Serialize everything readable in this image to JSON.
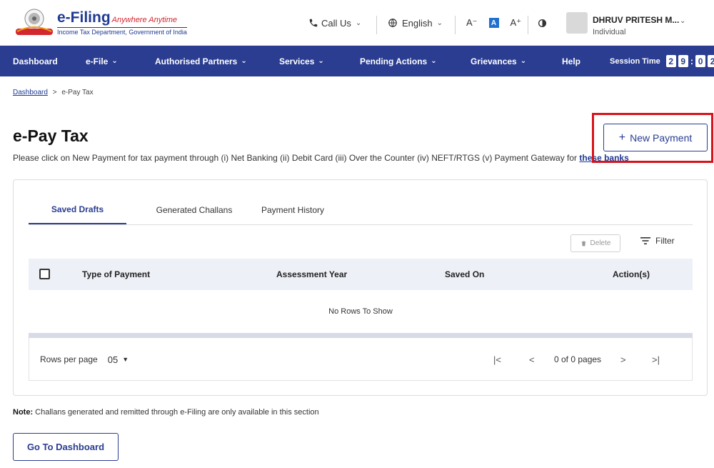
{
  "header": {
    "brand": "e-Filing",
    "tagline": "Anywhere Anytime",
    "subtitle": "Income Tax Department, Government of India",
    "call_us": "Call Us",
    "language": "English",
    "font_decrease": "A⁻",
    "font_normal": "A",
    "font_increase": "A⁺",
    "user_name": "DHRUV PRITESH M...",
    "user_role": "Individual"
  },
  "nav": {
    "items": [
      "Dashboard",
      "e-File",
      "Authorised Partners",
      "Services",
      "Pending Actions",
      "Grievances",
      "Help"
    ],
    "session_label": "Session Time",
    "session_digits": [
      "2",
      "9",
      "0",
      "2"
    ]
  },
  "breadcrumb": {
    "home": "Dashboard",
    "separator": ">",
    "current": "e-Pay Tax"
  },
  "page": {
    "title": "e-Pay Tax",
    "description": "Please click on New Payment for tax payment through (i) Net Banking (ii) Debit Card (iii) Over the Counter (iv) NEFT/RTGS (v) Payment Gateway for",
    "description_link": "these banks",
    "new_payment_label": "New Payment"
  },
  "tabs": [
    "Saved Drafts",
    "Generated Challans",
    "Payment History"
  ],
  "toolbar": {
    "delete_label": "Delete",
    "filter_label": "Filter"
  },
  "table": {
    "columns": [
      "Type of Payment",
      "Assessment Year",
      "Saved On",
      "Action(s)"
    ],
    "empty_message": "No Rows To Show"
  },
  "pagination": {
    "rows_per_page_label": "Rows per page",
    "rows_per_page_value": "05",
    "page_info": "0 of 0 pages"
  },
  "footer": {
    "note_label": "Note:",
    "note_text": "Challans generated and remitted through e-Filing are only available in this section",
    "dashboard_button": "Go To Dashboard"
  },
  "colors": {
    "primary": "#2a3d91",
    "highlight": "#d9121a"
  }
}
